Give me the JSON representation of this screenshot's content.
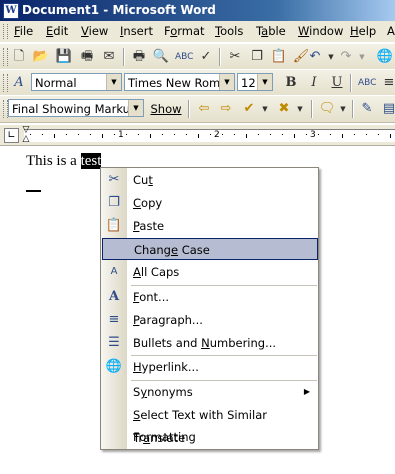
{
  "window": {
    "title": "Document1 - Microsoft Word",
    "app_icon": "W"
  },
  "menubar": {
    "items": [
      {
        "u": "F",
        "rest": "ile"
      },
      {
        "u": "E",
        "rest": "dit"
      },
      {
        "u": "V",
        "rest": "iew"
      },
      {
        "u": "I",
        "rest": "nsert"
      },
      {
        "u": "",
        "rest": "Format",
        "uMid": "o",
        "pre": "F",
        "post": "rmat"
      },
      {
        "u": "T",
        "rest": "ools"
      },
      {
        "u": "",
        "rest": "Table",
        "pre": "T",
        "uMid": "a",
        "post": "ble"
      },
      {
        "u": "W",
        "rest": "indow"
      },
      {
        "u": "H",
        "rest": "elp"
      },
      {
        "u": "",
        "rest": "A"
      }
    ]
  },
  "format_toolbar": {
    "style": "Normal",
    "font": "Times New Roman",
    "size": "12",
    "bold": "B",
    "italic": "I",
    "underline": "U"
  },
  "review_toolbar": {
    "markup": "Final Showing Markup",
    "show": "Show"
  },
  "ruler": {
    "numbers": [
      "1",
      "2",
      "3"
    ]
  },
  "document": {
    "text_before": "This is a ",
    "selected": "test"
  },
  "context_menu": {
    "items": [
      {
        "label": "Cut",
        "u": "t",
        "icon": "scissors-icon",
        "glyph": "✂"
      },
      {
        "label": "Copy",
        "u": "C",
        "icon": "copy-icon",
        "glyph": "❐"
      },
      {
        "label": "Paste",
        "u": "P",
        "icon": "paste-icon",
        "glyph": "📋"
      },
      {
        "label": "Change Case",
        "u": "e",
        "icon": "",
        "glyph": ""
      },
      {
        "label": "All Caps",
        "u": "A",
        "icon": "all-caps-icon",
        "glyph": "A"
      },
      {
        "label": "Font...",
        "u": "F",
        "icon": "font-icon",
        "glyph": "A"
      },
      {
        "label": "Paragraph...",
        "u": "P",
        "icon": "paragraph-icon",
        "glyph": "≡"
      },
      {
        "label": "Bullets and Numbering...",
        "u": "N",
        "icon": "bullets-icon",
        "glyph": "☰"
      },
      {
        "label": "Hyperlink...",
        "u": "H",
        "icon": "hyperlink-icon",
        "glyph": "🌐"
      },
      {
        "label": "Synonyms",
        "u": "y",
        "icon": "",
        "glyph": "",
        "submenu": "▶"
      },
      {
        "label": "Select Text with Similar Formatting",
        "u": "S",
        "icon": "",
        "glyph": ""
      },
      {
        "label": "Translate",
        "u": "a",
        "icon": "",
        "glyph": ""
      }
    ]
  }
}
